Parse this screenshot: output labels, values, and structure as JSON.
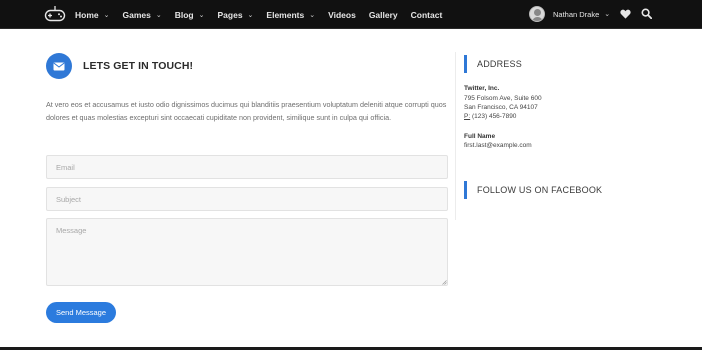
{
  "navbar": {
    "logo_icon": "gamepad-icon",
    "items": [
      {
        "label": "Home",
        "has_dropdown": true
      },
      {
        "label": "Games",
        "has_dropdown": true
      },
      {
        "label": "Blog",
        "has_dropdown": true
      },
      {
        "label": "Pages",
        "has_dropdown": true
      },
      {
        "label": "Elements",
        "has_dropdown": true
      },
      {
        "label": "Videos",
        "has_dropdown": false
      },
      {
        "label": "Gallery",
        "has_dropdown": false
      },
      {
        "label": "Contact",
        "has_dropdown": false
      }
    ],
    "user_name": "Nathan Drake",
    "icons": [
      "heart-icon",
      "search-icon"
    ],
    "background": "#111111"
  },
  "contact": {
    "title": "LETS GET IN TOUCH!",
    "intro": "At vero eos et accusamus et iusto odio dignissimos ducimus qui blanditiis praesentium voluptatum deleniti atque corrupti quos dolores et quas molestias excepturi sint occaecati cupiditate non provident, similique sunt in culpa qui officia.",
    "email_placeholder": "Email",
    "subject_placeholder": "Subject",
    "message_placeholder": "Message",
    "send_label": "Send Message",
    "accent": "#2f78d6"
  },
  "sidebar": {
    "address_heading": "ADDRESS",
    "company": "Twitter, Inc.",
    "street": "795 Folsom Ave, Suite 600",
    "city": "San Francisco, CA 94107",
    "phone_prefix": "P:",
    "phone": "(123) 456-7890",
    "contact_name": "Full Name",
    "contact_email": "first.last@example.com",
    "facebook_heading": "FOLLOW US ON FACEBOOK"
  }
}
